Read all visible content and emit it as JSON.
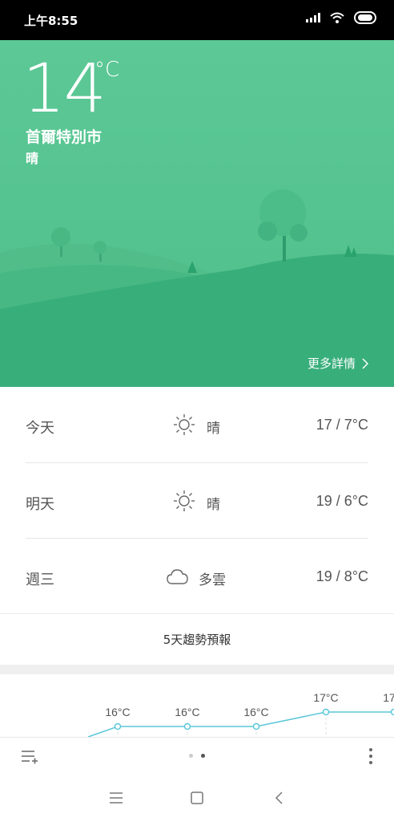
{
  "status_bar": {
    "time": "上午8:55"
  },
  "current": {
    "temperature": "14",
    "unit": "°C",
    "city": "首爾特別市",
    "condition": "晴",
    "more_details": "更多詳情"
  },
  "forecast": [
    {
      "day": "今天",
      "icon": "sun-icon",
      "condition": "晴",
      "range": "17 / 7°C"
    },
    {
      "day": "明天",
      "icon": "sun-icon",
      "condition": "晴",
      "range": "19 / 6°C"
    },
    {
      "day": "週三",
      "icon": "cloud-icon",
      "condition": "多雲",
      "range": "19 / 8°C"
    }
  ],
  "trend_button": "5天趨勢預報",
  "trend_chart": {
    "high_labels": [
      "16°C",
      "16°C",
      "16°C",
      "17°C",
      "17"
    ]
  },
  "colors": {
    "hero_bg": "#5bc795",
    "accent_line": "#5bc8d8"
  }
}
